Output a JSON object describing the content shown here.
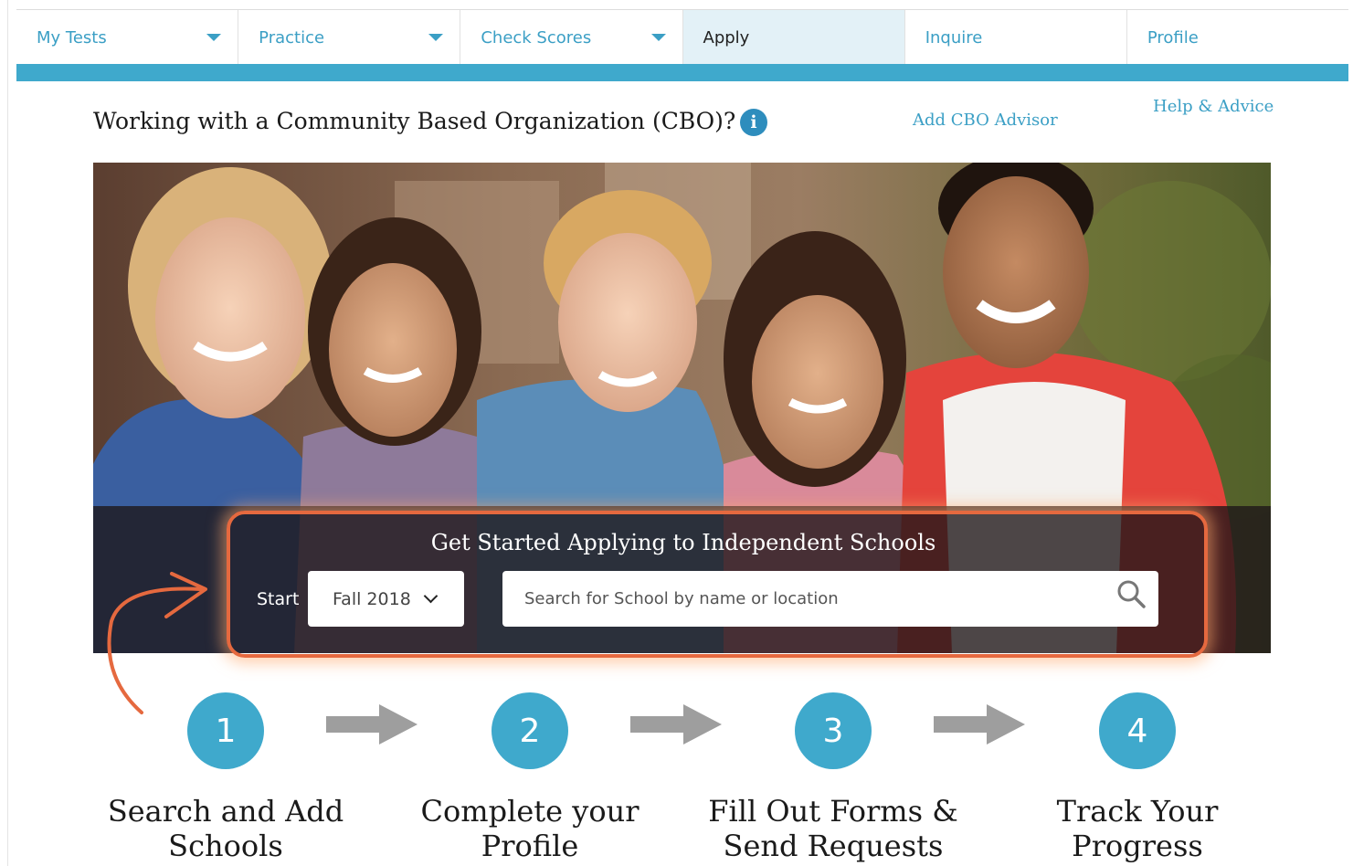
{
  "nav": {
    "tabs": [
      {
        "label": "My Tests",
        "dropdown": true,
        "active": false
      },
      {
        "label": "Practice",
        "dropdown": true,
        "active": false
      },
      {
        "label": "Check Scores",
        "dropdown": true,
        "active": false
      },
      {
        "label": "Apply",
        "dropdown": false,
        "active": true
      },
      {
        "label": "Inquire",
        "dropdown": false,
        "active": false
      },
      {
        "label": "Profile",
        "dropdown": false,
        "active": false
      }
    ]
  },
  "cbo": {
    "question": "Working with a Community Based Organization (CBO)?",
    "info_icon": "info-icon",
    "add_advisor_link": "Add CBO Advisor"
  },
  "help_link": "Help & Advice",
  "hero": {
    "cta_title": "Get Started Applying to Independent Schools",
    "start_label": "Start",
    "term_select_value": "Fall 2018",
    "search_placeholder": "Search for School by name or location",
    "search_icon": "search-icon",
    "highlight_color": "#e5693f"
  },
  "steps": [
    {
      "number": "1",
      "label_line1": "Search and Add",
      "label_line2": "Schools"
    },
    {
      "number": "2",
      "label_line1": "Complete your",
      "label_line2": "Profile"
    },
    {
      "number": "3",
      "label_line1": "Fill Out Forms &",
      "label_line2": "Send Requests"
    },
    {
      "number": "4",
      "label_line1": "Track Your",
      "label_line2": "Progress"
    }
  ],
  "colors": {
    "accent": "#3fa9cc",
    "link": "#3b9fc5",
    "active_tab_bg": "#e3f1f7",
    "highlight": "#e5693f"
  }
}
